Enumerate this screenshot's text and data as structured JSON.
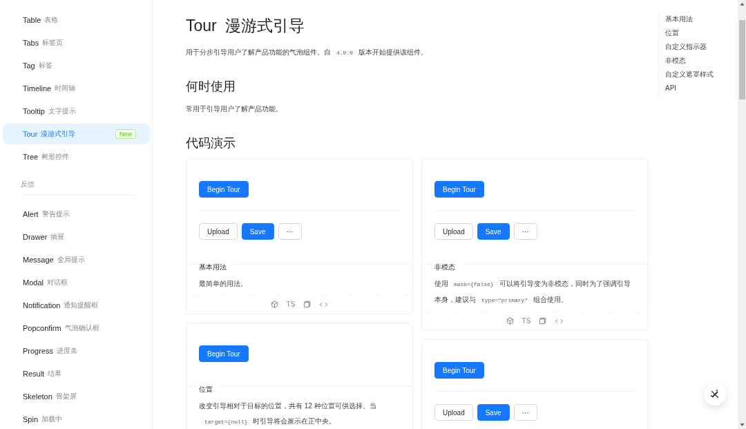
{
  "sidebar": {
    "items": [
      {
        "kind": "item",
        "label": "Table",
        "sublabel": "表格",
        "selected": false
      },
      {
        "kind": "item",
        "label": "Tabs",
        "sublabel": "标签页",
        "selected": false
      },
      {
        "kind": "item",
        "label": "Tag",
        "sublabel": "标签",
        "selected": false
      },
      {
        "kind": "item",
        "label": "Timeline",
        "sublabel": "时间轴",
        "selected": false
      },
      {
        "kind": "item",
        "label": "Tooltip",
        "sublabel": "文字提示",
        "selected": false
      },
      {
        "kind": "item",
        "label": "Tour",
        "sublabel": "漫游式引导",
        "selected": true,
        "badge": "New"
      },
      {
        "kind": "item",
        "label": "Tree",
        "sublabel": "树形控件",
        "selected": false
      },
      {
        "kind": "group",
        "label": "反馈"
      },
      {
        "kind": "item",
        "label": "Alert",
        "sublabel": "警告提示",
        "selected": false
      },
      {
        "kind": "item",
        "label": "Drawer",
        "sublabel": "抽屉",
        "selected": false
      },
      {
        "kind": "item",
        "label": "Message",
        "sublabel": "全局提示",
        "selected": false
      },
      {
        "kind": "item",
        "label": "Modal",
        "sublabel": "对话框",
        "selected": false
      },
      {
        "kind": "item",
        "label": "Notification",
        "sublabel": "通知提醒框",
        "selected": false
      },
      {
        "kind": "item",
        "label": "Popconfirm",
        "sublabel": "气泡确认框",
        "selected": false
      },
      {
        "kind": "item",
        "label": "Progress",
        "sublabel": "进度条",
        "selected": false
      },
      {
        "kind": "item",
        "label": "Result",
        "sublabel": "结果",
        "selected": false
      },
      {
        "kind": "item",
        "label": "Skeleton",
        "sublabel": "骨架屏",
        "selected": false
      },
      {
        "kind": "item",
        "label": "Spin",
        "sublabel": "加载中",
        "selected": false
      }
    ]
  },
  "page": {
    "title": "Tour",
    "subtitle": "漫游式引导",
    "intro": [
      {
        "kind": "text",
        "text": "用于分步引导用户了解产品功能的气泡组件。自"
      },
      {
        "kind": "code",
        "text": "4.0.0"
      },
      {
        "kind": "text",
        "text": "版本开始提供该组件。"
      }
    ],
    "when_heading": "何时使用",
    "when_text": "常用于引导用户了解产品功能。",
    "demo_heading": "代码演示"
  },
  "demo_columns": [
    {
      "cards": [
        {
          "begin": "Begin Tour",
          "buttons": [
            "Upload",
            "Save",
            "···"
          ],
          "title": "基本用法",
          "description": [
            {
              "kind": "text",
              "text": "最简单的用法。"
            }
          ],
          "actions": "TS"
        },
        {
          "begin": "Begin Tour",
          "title": "位置",
          "description": [
            {
              "kind": "text",
              "text": "改变引导相对于目标的位置，共有 12 种位置可供选择。当"
            },
            {
              "kind": "code",
              "text": "target={null}"
            },
            {
              "kind": "text",
              "text": "时引导将会展示在正中央。"
            }
          ]
        }
      ]
    },
    {
      "cards": [
        {
          "begin": "Begin Tour",
          "buttons": [
            "Upload",
            "Save",
            "···"
          ],
          "title": "非模态",
          "description": [
            {
              "kind": "text",
              "text": "使用"
            },
            {
              "kind": "code",
              "text": "mask={false}"
            },
            {
              "kind": "text",
              "text": "可以将引导变为非模态，同时为了强调引导本身，建议与"
            },
            {
              "kind": "code",
              "text": "type=\"primary\""
            },
            {
              "kind": "text",
              "text": "组合使用。"
            }
          ],
          "actions": "TS"
        },
        {
          "begin": "Begin Tour",
          "buttons": [
            "Upload",
            "Save",
            "···"
          ]
        }
      ]
    }
  ],
  "toc": [
    "基本用法",
    "位置",
    "自定义指示器",
    "非模态",
    "自定义遮罩样式",
    "API"
  ]
}
